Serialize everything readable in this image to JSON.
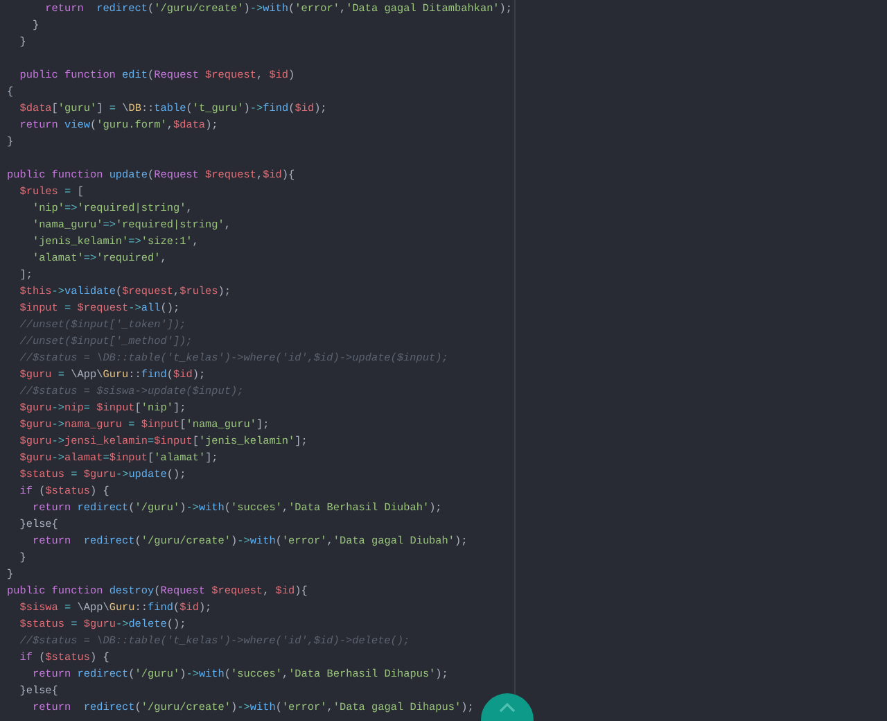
{
  "editor": {
    "lines": [
      {
        "kind": "code",
        "tokens": [
          {
            "text": "      return",
            "kind": "keyword"
          },
          {
            "text": "  redirect",
            "kind": "function"
          },
          {
            "text": "(",
            "kind": "plain"
          },
          {
            "text": "'/guru/create'",
            "kind": "string"
          },
          {
            "text": ")",
            "kind": "plain"
          },
          {
            "text": "->",
            "kind": "operator"
          },
          {
            "text": "with",
            "kind": "function"
          },
          {
            "text": "(",
            "kind": "plain"
          },
          {
            "text": "'error'",
            "kind": "string"
          },
          {
            "text": ",",
            "kind": "plain"
          },
          {
            "text": "'Data gagal Ditambahkan'",
            "kind": "string"
          },
          {
            "text": ");",
            "kind": "plain"
          }
        ]
      },
      {
        "kind": "code",
        "tokens": [
          {
            "text": "    }",
            "kind": "plain"
          }
        ]
      },
      {
        "kind": "code",
        "tokens": [
          {
            "text": "  }",
            "kind": "plain"
          }
        ]
      },
      {
        "kind": "blank"
      },
      {
        "kind": "code",
        "tokens": [
          {
            "text": "  public function",
            "kind": "keyword"
          },
          {
            "text": " edit",
            "kind": "function"
          },
          {
            "text": "(",
            "kind": "plain"
          },
          {
            "text": "Request",
            "kind": "keyword"
          },
          {
            "text": " $request",
            "kind": "variable"
          },
          {
            "text": ", ",
            "kind": "plain"
          },
          {
            "text": "$id",
            "kind": "variable"
          },
          {
            "text": ")",
            "kind": "plain"
          }
        ]
      },
      {
        "kind": "code",
        "tokens": [
          {
            "text": "{",
            "kind": "plain"
          }
        ]
      },
      {
        "kind": "code",
        "tokens": [
          {
            "text": "  $data",
            "kind": "variable"
          },
          {
            "text": "[",
            "kind": "plain"
          },
          {
            "text": "'guru'",
            "kind": "string"
          },
          {
            "text": "] ",
            "kind": "plain"
          },
          {
            "text": "=",
            "kind": "operator"
          },
          {
            "text": " \\",
            "kind": "plain"
          },
          {
            "text": "DB",
            "kind": "class"
          },
          {
            "text": "::",
            "kind": "plain"
          },
          {
            "text": "table",
            "kind": "function"
          },
          {
            "text": "(",
            "kind": "plain"
          },
          {
            "text": "'t_guru'",
            "kind": "string"
          },
          {
            "text": ")",
            "kind": "plain"
          },
          {
            "text": "->",
            "kind": "operator"
          },
          {
            "text": "find",
            "kind": "function"
          },
          {
            "text": "(",
            "kind": "plain"
          },
          {
            "text": "$id",
            "kind": "variable"
          },
          {
            "text": ");",
            "kind": "plain"
          }
        ]
      },
      {
        "kind": "code",
        "tokens": [
          {
            "text": "  return",
            "kind": "keyword"
          },
          {
            "text": " view",
            "kind": "function"
          },
          {
            "text": "(",
            "kind": "plain"
          },
          {
            "text": "'guru.form'",
            "kind": "string"
          },
          {
            "text": ",",
            "kind": "plain"
          },
          {
            "text": "$data",
            "kind": "variable"
          },
          {
            "text": ");",
            "kind": "plain"
          }
        ]
      },
      {
        "kind": "code",
        "tokens": [
          {
            "text": "}",
            "kind": "plain"
          }
        ]
      },
      {
        "kind": "blank"
      },
      {
        "kind": "code",
        "tokens": [
          {
            "text": "public function",
            "kind": "keyword"
          },
          {
            "text": " update",
            "kind": "function"
          },
          {
            "text": "(",
            "kind": "plain"
          },
          {
            "text": "Request",
            "kind": "keyword"
          },
          {
            "text": " $request",
            "kind": "variable"
          },
          {
            "text": ",",
            "kind": "plain"
          },
          {
            "text": "$id",
            "kind": "variable"
          },
          {
            "text": "){",
            "kind": "plain"
          }
        ]
      },
      {
        "kind": "code",
        "tokens": [
          {
            "text": "  $rules",
            "kind": "variable"
          },
          {
            "text": " =",
            "kind": "operator"
          },
          {
            "text": " [",
            "kind": "plain"
          }
        ]
      },
      {
        "kind": "code",
        "tokens": [
          {
            "text": "    'nip'",
            "kind": "string"
          },
          {
            "text": "=>",
            "kind": "operator"
          },
          {
            "text": "'required|string'",
            "kind": "string"
          },
          {
            "text": ",",
            "kind": "plain"
          }
        ]
      },
      {
        "kind": "code",
        "tokens": [
          {
            "text": "    'nama_guru'",
            "kind": "string"
          },
          {
            "text": "=>",
            "kind": "operator"
          },
          {
            "text": "'required|string'",
            "kind": "string"
          },
          {
            "text": ",",
            "kind": "plain"
          }
        ]
      },
      {
        "kind": "code",
        "tokens": [
          {
            "text": "    'jenis_kelamin'",
            "kind": "string"
          },
          {
            "text": "=>",
            "kind": "operator"
          },
          {
            "text": "'size:1'",
            "kind": "string"
          },
          {
            "text": ",",
            "kind": "plain"
          }
        ]
      },
      {
        "kind": "code",
        "tokens": [
          {
            "text": "    'alamat'",
            "kind": "string"
          },
          {
            "text": "=>",
            "kind": "operator"
          },
          {
            "text": "'required'",
            "kind": "string"
          },
          {
            "text": ",",
            "kind": "plain"
          }
        ]
      },
      {
        "kind": "code",
        "tokens": [
          {
            "text": "  ];",
            "kind": "plain"
          }
        ]
      },
      {
        "kind": "code",
        "tokens": [
          {
            "text": "  $this",
            "kind": "variable"
          },
          {
            "text": "->",
            "kind": "operator"
          },
          {
            "text": "validate",
            "kind": "function"
          },
          {
            "text": "(",
            "kind": "plain"
          },
          {
            "text": "$request",
            "kind": "variable"
          },
          {
            "text": ",",
            "kind": "plain"
          },
          {
            "text": "$rules",
            "kind": "variable"
          },
          {
            "text": ");",
            "kind": "plain"
          }
        ]
      },
      {
        "kind": "code",
        "tokens": [
          {
            "text": "  $input",
            "kind": "variable"
          },
          {
            "text": " =",
            "kind": "operator"
          },
          {
            "text": " $request",
            "kind": "variable"
          },
          {
            "text": "->",
            "kind": "operator"
          },
          {
            "text": "all",
            "kind": "function"
          },
          {
            "text": "();",
            "kind": "plain"
          }
        ]
      },
      {
        "kind": "code",
        "tokens": [
          {
            "text": "  //unset($input['_token']);",
            "kind": "comment"
          }
        ]
      },
      {
        "kind": "code",
        "tokens": [
          {
            "text": "  //unset($input['_method']);",
            "kind": "comment"
          }
        ]
      },
      {
        "kind": "code",
        "tokens": [
          {
            "text": "  //$status = \\DB::table('t_kelas')->where('id',$id)->update($input);",
            "kind": "comment"
          }
        ]
      },
      {
        "kind": "code",
        "tokens": [
          {
            "text": "  $guru",
            "kind": "variable"
          },
          {
            "text": " =",
            "kind": "operator"
          },
          {
            "text": " \\App\\",
            "kind": "plain"
          },
          {
            "text": "Guru",
            "kind": "class"
          },
          {
            "text": "::",
            "kind": "plain"
          },
          {
            "text": "find",
            "kind": "function"
          },
          {
            "text": "(",
            "kind": "plain"
          },
          {
            "text": "$id",
            "kind": "variable"
          },
          {
            "text": ");",
            "kind": "plain"
          }
        ]
      },
      {
        "kind": "code",
        "tokens": [
          {
            "text": "  //$status = $siswa->update($input);",
            "kind": "comment"
          }
        ]
      },
      {
        "kind": "code",
        "tokens": [
          {
            "text": "  $guru",
            "kind": "variable"
          },
          {
            "text": "->",
            "kind": "operator"
          },
          {
            "text": "nip",
            "kind": "variable"
          },
          {
            "text": "=",
            "kind": "operator"
          },
          {
            "text": " $input",
            "kind": "variable"
          },
          {
            "text": "[",
            "kind": "plain"
          },
          {
            "text": "'nip'",
            "kind": "string"
          },
          {
            "text": "];",
            "kind": "plain"
          }
        ]
      },
      {
        "kind": "code",
        "tokens": [
          {
            "text": "  $guru",
            "kind": "variable"
          },
          {
            "text": "->",
            "kind": "operator"
          },
          {
            "text": "nama_guru",
            "kind": "variable"
          },
          {
            "text": " =",
            "kind": "operator"
          },
          {
            "text": " $input",
            "kind": "variable"
          },
          {
            "text": "[",
            "kind": "plain"
          },
          {
            "text": "'nama_guru'",
            "kind": "string"
          },
          {
            "text": "];",
            "kind": "plain"
          }
        ]
      },
      {
        "kind": "code",
        "tokens": [
          {
            "text": "  $guru",
            "kind": "variable"
          },
          {
            "text": "->",
            "kind": "operator"
          },
          {
            "text": "jensi_kelamin",
            "kind": "variable"
          },
          {
            "text": "=",
            "kind": "operator"
          },
          {
            "text": "$input",
            "kind": "variable"
          },
          {
            "text": "[",
            "kind": "plain"
          },
          {
            "text": "'jenis_kelamin'",
            "kind": "string"
          },
          {
            "text": "];",
            "kind": "plain"
          }
        ]
      },
      {
        "kind": "code",
        "tokens": [
          {
            "text": "  $guru",
            "kind": "variable"
          },
          {
            "text": "->",
            "kind": "operator"
          },
          {
            "text": "alamat",
            "kind": "variable"
          },
          {
            "text": "=",
            "kind": "operator"
          },
          {
            "text": "$input",
            "kind": "variable"
          },
          {
            "text": "[",
            "kind": "plain"
          },
          {
            "text": "'alamat'",
            "kind": "string"
          },
          {
            "text": "];",
            "kind": "plain"
          }
        ]
      },
      {
        "kind": "code",
        "tokens": [
          {
            "text": "  $status",
            "kind": "variable"
          },
          {
            "text": " =",
            "kind": "operator"
          },
          {
            "text": " $guru",
            "kind": "variable"
          },
          {
            "text": "->",
            "kind": "operator"
          },
          {
            "text": "update",
            "kind": "function"
          },
          {
            "text": "();",
            "kind": "plain"
          }
        ]
      },
      {
        "kind": "code",
        "tokens": [
          {
            "text": "  if",
            "kind": "keyword"
          },
          {
            "text": " (",
            "kind": "plain"
          },
          {
            "text": "$status",
            "kind": "variable"
          },
          {
            "text": ") {",
            "kind": "plain"
          }
        ]
      },
      {
        "kind": "code",
        "tokens": [
          {
            "text": "    return",
            "kind": "keyword"
          },
          {
            "text": " redirect",
            "kind": "function"
          },
          {
            "text": "(",
            "kind": "plain"
          },
          {
            "text": "'/guru'",
            "kind": "string"
          },
          {
            "text": ")",
            "kind": "plain"
          },
          {
            "text": "->",
            "kind": "operator"
          },
          {
            "text": "with",
            "kind": "function"
          },
          {
            "text": "(",
            "kind": "plain"
          },
          {
            "text": "'succes'",
            "kind": "string"
          },
          {
            "text": ",",
            "kind": "plain"
          },
          {
            "text": "'Data Berhasil Diubah'",
            "kind": "string"
          },
          {
            "text": ");",
            "kind": "plain"
          }
        ]
      },
      {
        "kind": "code",
        "tokens": [
          {
            "text": "  }else{",
            "kind": "plain"
          }
        ]
      },
      {
        "kind": "code",
        "tokens": [
          {
            "text": "    return",
            "kind": "keyword"
          },
          {
            "text": "  redirect",
            "kind": "function"
          },
          {
            "text": "(",
            "kind": "plain"
          },
          {
            "text": "'/guru/create'",
            "kind": "string"
          },
          {
            "text": ")",
            "kind": "plain"
          },
          {
            "text": "->",
            "kind": "operator"
          },
          {
            "text": "with",
            "kind": "function"
          },
          {
            "text": "(",
            "kind": "plain"
          },
          {
            "text": "'error'",
            "kind": "string"
          },
          {
            "text": ",",
            "kind": "plain"
          },
          {
            "text": "'Data gagal Diubah'",
            "kind": "string"
          },
          {
            "text": ");",
            "kind": "plain"
          }
        ]
      },
      {
        "kind": "code",
        "tokens": [
          {
            "text": "  }",
            "kind": "plain"
          }
        ]
      },
      {
        "kind": "code",
        "tokens": [
          {
            "text": "}",
            "kind": "plain"
          }
        ]
      },
      {
        "kind": "code",
        "tokens": [
          {
            "text": "public function",
            "kind": "keyword"
          },
          {
            "text": " destroy",
            "kind": "function"
          },
          {
            "text": "(",
            "kind": "plain"
          },
          {
            "text": "Request",
            "kind": "keyword"
          },
          {
            "text": " $request",
            "kind": "variable"
          },
          {
            "text": ", ",
            "kind": "plain"
          },
          {
            "text": "$id",
            "kind": "variable"
          },
          {
            "text": "){",
            "kind": "plain"
          }
        ]
      },
      {
        "kind": "code",
        "tokens": [
          {
            "text": "  $siswa",
            "kind": "variable"
          },
          {
            "text": " =",
            "kind": "operator"
          },
          {
            "text": " \\App\\",
            "kind": "plain"
          },
          {
            "text": "Guru",
            "kind": "class"
          },
          {
            "text": "::",
            "kind": "plain"
          },
          {
            "text": "find",
            "kind": "function"
          },
          {
            "text": "(",
            "kind": "plain"
          },
          {
            "text": "$id",
            "kind": "variable"
          },
          {
            "text": ");",
            "kind": "plain"
          }
        ]
      },
      {
        "kind": "code",
        "tokens": [
          {
            "text": "  $status",
            "kind": "variable"
          },
          {
            "text": " =",
            "kind": "operator"
          },
          {
            "text": " $guru",
            "kind": "variable"
          },
          {
            "text": "->",
            "kind": "operator"
          },
          {
            "text": "delete",
            "kind": "function"
          },
          {
            "text": "();",
            "kind": "plain"
          }
        ]
      },
      {
        "kind": "code",
        "tokens": [
          {
            "text": "  //$status = \\DB::table('t_kelas')->where('id',$id)->delete();",
            "kind": "comment"
          }
        ]
      },
      {
        "kind": "code",
        "tokens": [
          {
            "text": "  if",
            "kind": "keyword"
          },
          {
            "text": " (",
            "kind": "plain"
          },
          {
            "text": "$status",
            "kind": "variable"
          },
          {
            "text": ") {",
            "kind": "plain"
          }
        ]
      },
      {
        "kind": "code",
        "tokens": [
          {
            "text": "    return",
            "kind": "keyword"
          },
          {
            "text": " redirect",
            "kind": "function"
          },
          {
            "text": "(",
            "kind": "plain"
          },
          {
            "text": "'/guru'",
            "kind": "string"
          },
          {
            "text": ")",
            "kind": "plain"
          },
          {
            "text": "->",
            "kind": "operator"
          },
          {
            "text": "with",
            "kind": "function"
          },
          {
            "text": "(",
            "kind": "plain"
          },
          {
            "text": "'succes'",
            "kind": "string"
          },
          {
            "text": ",",
            "kind": "plain"
          },
          {
            "text": "'Data Berhasil Dihapus'",
            "kind": "string"
          },
          {
            "text": ");",
            "kind": "plain"
          }
        ]
      },
      {
        "kind": "code",
        "tokens": [
          {
            "text": "  }else{",
            "kind": "plain"
          }
        ]
      },
      {
        "kind": "code",
        "tokens": [
          {
            "text": "    return",
            "kind": "keyword"
          },
          {
            "text": "  redirect",
            "kind": "function"
          },
          {
            "text": "(",
            "kind": "plain"
          },
          {
            "text": "'/guru/create'",
            "kind": "string"
          },
          {
            "text": ")",
            "kind": "plain"
          },
          {
            "text": "->",
            "kind": "operator"
          },
          {
            "text": "with",
            "kind": "function"
          },
          {
            "text": "(",
            "kind": "plain"
          },
          {
            "text": "'error'",
            "kind": "string"
          },
          {
            "text": ",",
            "kind": "plain"
          },
          {
            "text": "'Data gagal Dihapus'",
            "kind": "string"
          },
          {
            "text": ");",
            "kind": "plain"
          }
        ]
      }
    ]
  }
}
